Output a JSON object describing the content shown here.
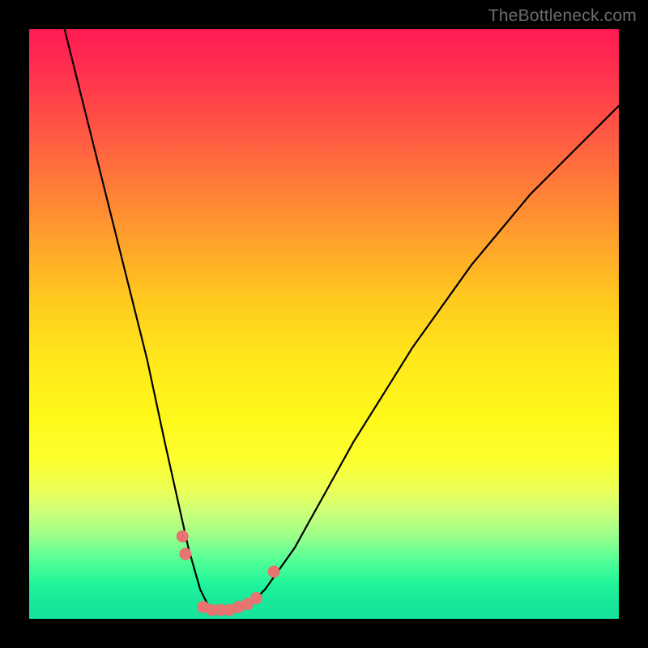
{
  "watermark": "TheBottleneck.com",
  "chart_data": {
    "type": "line",
    "title": "",
    "xlabel": "",
    "ylabel": "",
    "xlim": [
      0,
      100
    ],
    "ylim": [
      0,
      100
    ],
    "grid": false,
    "legend": false,
    "background": {
      "gradient": "vertical",
      "stops": [
        {
          "pos": 0,
          "color": "#ff1a54"
        },
        {
          "pos": 50,
          "color": "#ffe81a"
        },
        {
          "pos": 100,
          "color": "#16e29a"
        }
      ]
    },
    "series": [
      {
        "name": "bottleneck-curve",
        "x": [
          6,
          10,
          15,
          20,
          23,
          25,
          27,
          29,
          30.5,
          32,
          34,
          37,
          40,
          45,
          50,
          55,
          60,
          65,
          70,
          75,
          80,
          85,
          90,
          95,
          100
        ],
        "values": [
          100,
          84,
          64,
          44,
          30,
          21,
          12,
          5,
          2,
          1,
          1,
          2,
          5,
          12,
          21,
          30,
          38,
          46,
          53,
          60,
          66,
          72,
          77,
          82,
          87
        ]
      }
    ],
    "markers": [
      {
        "x": 26.0,
        "y": 14.0
      },
      {
        "x": 26.5,
        "y": 11.0
      },
      {
        "x": 29.5,
        "y": 2.0
      },
      {
        "x": 31.0,
        "y": 1.5
      },
      {
        "x": 32.5,
        "y": 1.5
      },
      {
        "x": 34.0,
        "y": 1.5
      },
      {
        "x": 35.5,
        "y": 2.0
      },
      {
        "x": 37.0,
        "y": 2.5
      },
      {
        "x": 38.5,
        "y": 3.5
      },
      {
        "x": 41.5,
        "y": 8.0
      }
    ],
    "marker_color": "#e77470"
  }
}
